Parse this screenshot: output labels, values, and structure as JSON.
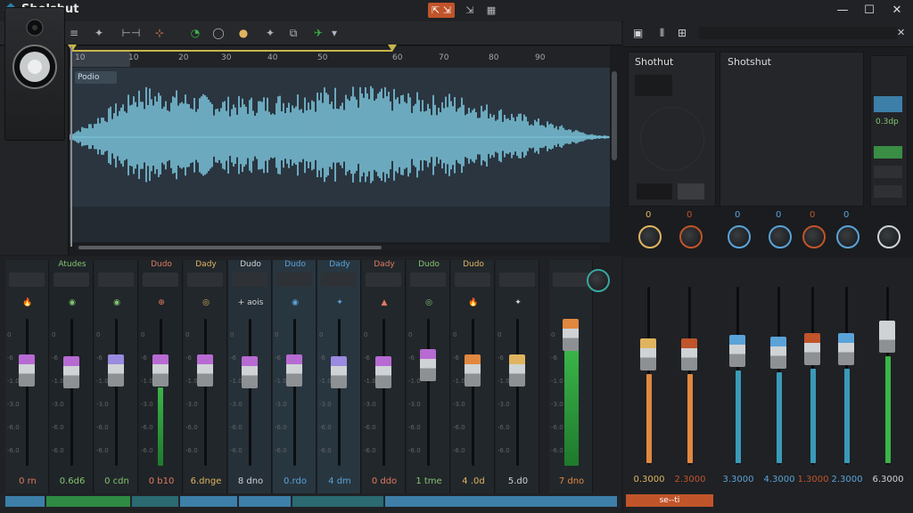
{
  "app": {
    "title": "Sholshut"
  },
  "titlebar": {
    "mid_buttons": [
      "⇱ ⇲",
      "⇲",
      "▦",
      "▭"
    ],
    "minimize": "—",
    "maximize": "☐",
    "close": "✕"
  },
  "toolbar": {
    "tools": [
      "≡",
      "◎",
      "⌂",
      "≡",
      "✦",
      "⊢⊣",
      "⊹",
      "◔",
      "◯",
      "●",
      "✦",
      "⧉",
      "✈",
      "▾"
    ]
  },
  "timeline": {
    "ruler_labels": [
      "10",
      "10",
      "20",
      "30",
      "40",
      "50",
      "60",
      "70",
      "80",
      "90"
    ],
    "clip_label": "Podio"
  },
  "right_panel": {
    "toolbar_icons": [
      "▣",
      "⫴",
      "⊞",
      "✕"
    ],
    "panel_a_title": "Shothut",
    "panel_b_title": "Shotshut",
    "top_values": [
      "0",
      "0",
      "0",
      "0",
      "0",
      "0"
    ],
    "channel_values": [
      "0.3000",
      "2.3000",
      "3.3000",
      "4.3000",
      "1.3000",
      "2.3000",
      "6.3000"
    ],
    "side_label": "0.3dp",
    "bottom_label": "se--ti"
  },
  "mixer": {
    "channels": [
      {
        "name": "",
        "value": "0 rn",
        "color": "#e07a5f",
        "icon": "🔥",
        "cap": "#b86ad3"
      },
      {
        "name": "Atudes",
        "value": "0.6d6",
        "color": "#82c46f",
        "icon": "◉",
        "cap": "#b86ad3"
      },
      {
        "name": "",
        "value": "0 cdn",
        "color": "#82c46f",
        "icon": "◉",
        "cap": "#9a8ae0"
      },
      {
        "name": "Dudo",
        "value": "0 b10",
        "color": "#e07a5f",
        "icon": "⊕",
        "cap": "#b86ad3"
      },
      {
        "name": "Dady",
        "value": "6.dnge",
        "color": "#e0b45f",
        "icon": "◎",
        "cap": "#b86ad3"
      },
      {
        "name": "Dudo",
        "value": "8 dno",
        "color": "#cfd3d6",
        "icon": "+ aois",
        "cap": "#b86ad3"
      },
      {
        "name": "Dudo",
        "value": "0.rdo",
        "color": "#5aa3d8",
        "icon": "◉",
        "cap": "#b86ad3"
      },
      {
        "name": "Dady",
        "value": "4 dm",
        "color": "#5aa3d8",
        "icon": "✦",
        "cap": "#9a8ae0"
      },
      {
        "name": "Dady",
        "value": "0 ddo",
        "color": "#e07a5f",
        "icon": "▲",
        "cap": "#b86ad3"
      },
      {
        "name": "Dudo",
        "value": "1 tme",
        "color": "#82c46f",
        "icon": "◎",
        "cap": "#b86ad3"
      },
      {
        "name": "Dudo",
        "value": "4 .0d",
        "color": "#e0b45f",
        "icon": "🔥",
        "cap": "#e0883f"
      },
      {
        "name": "",
        "value": "5.d0",
        "color": "#cfd3d6",
        "icon": "✦",
        "cap": "#e0b45f"
      },
      {
        "name": "",
        "value": "7 dno",
        "color": "#e0883f",
        "icon": "",
        "cap": "#e0883f"
      }
    ],
    "db_scale": [
      "0",
      "-6",
      "-1.0",
      "-3.0",
      "-6.0",
      "-6.0"
    ]
  },
  "colors": {
    "accent_orange": "#c0542a",
    "wave": "#7cc7de",
    "meter_green": "#3bb54a"
  }
}
